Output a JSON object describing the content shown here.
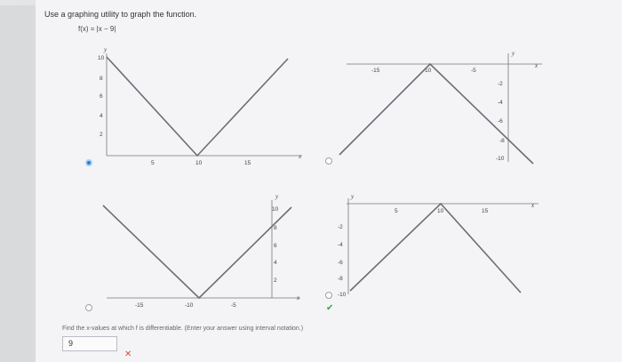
{
  "question": "Use a graphing utility to graph the function.",
  "function": "f(x) = |x − 9|",
  "graphs": [
    {
      "selected": true,
      "x_ticks": [
        "5",
        "10",
        "15"
      ],
      "y_ticks": [
        "10",
        "8",
        "6",
        "4",
        "2"
      ],
      "x_label": "x",
      "y_label": "y"
    },
    {
      "selected": false,
      "x_ticks": [
        "-15",
        "-10",
        "-5"
      ],
      "y_ticks": [
        "-2",
        "-4",
        "-6",
        "-8",
        "-10"
      ],
      "x_label": "x",
      "y_label": "y"
    },
    {
      "selected": false,
      "x_ticks": [
        "-15",
        "-10",
        "-5"
      ],
      "y_ticks": [
        "10",
        "8",
        "6",
        "4",
        "2"
      ],
      "x_label": "x",
      "y_label": "y"
    },
    {
      "selected": false,
      "x_ticks": [
        "5",
        "10",
        "15"
      ],
      "y_ticks": [
        "-2",
        "-4",
        "-6",
        "-8",
        "-10"
      ],
      "x_label": "x",
      "y_label": "y"
    }
  ],
  "check_mark": "✔",
  "prompt": "Find the x-values at which f is differentiable. (Enter your answer using interval notation.)",
  "answer_value": "9",
  "x_mark": "✕",
  "colors": {
    "line": "#6d6d75",
    "radio_selected": "#2a7fd4",
    "check": "#3aa14a",
    "error": "#e24a3b"
  }
}
